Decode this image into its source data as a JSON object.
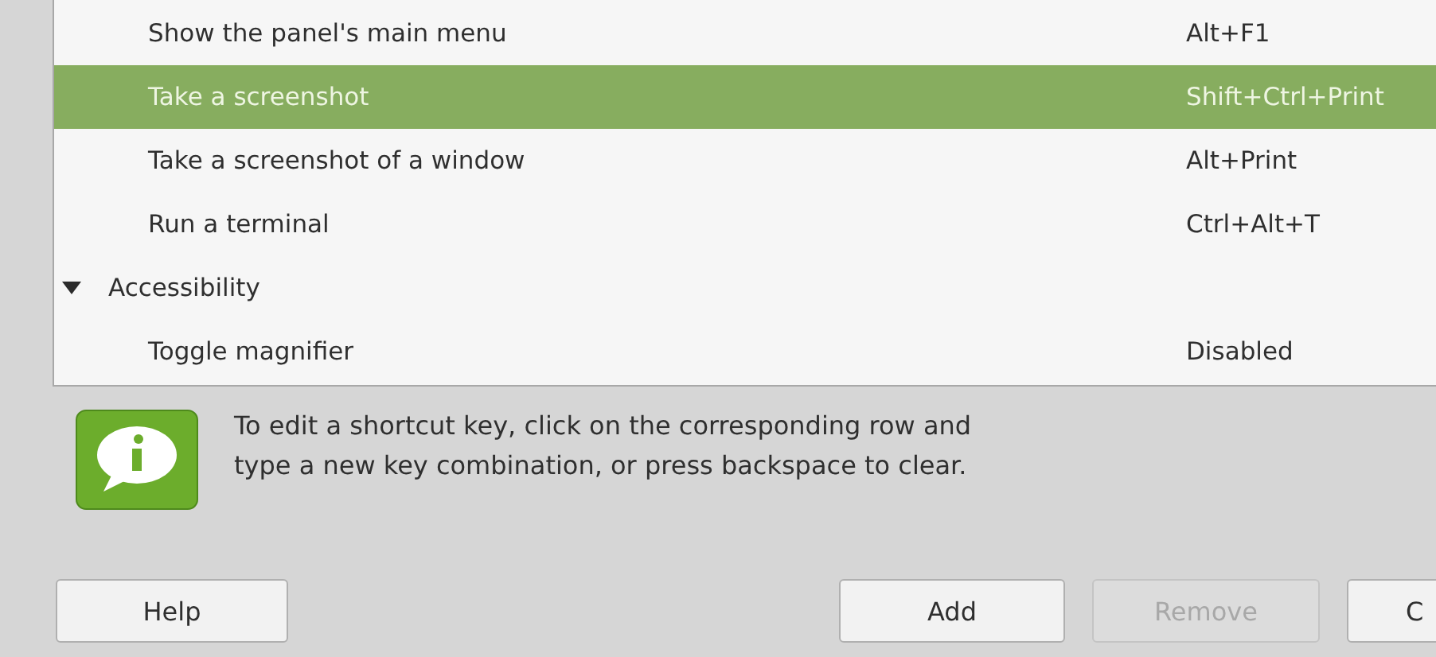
{
  "shortcuts": [
    {
      "kind": "shortcut",
      "label": "Show the panel's main menu",
      "keys": "Alt+F1",
      "selected": false
    },
    {
      "kind": "shortcut",
      "label": "Take a screenshot",
      "keys": "Shift+Ctrl+Print",
      "selected": true
    },
    {
      "kind": "shortcut",
      "label": "Take a screenshot of a window",
      "keys": "Alt+Print",
      "selected": false
    },
    {
      "kind": "shortcut",
      "label": "Run a terminal",
      "keys": "Ctrl+Alt+T",
      "selected": false
    },
    {
      "kind": "category",
      "label": "Accessibility",
      "expanded": true,
      "selected": false
    },
    {
      "kind": "shortcut",
      "label": "Toggle magnifier",
      "keys": "Disabled",
      "selected": false
    }
  ],
  "info": {
    "text": "To edit a shortcut key, click on the corresponding row and type a new key combination, or press backspace to clear."
  },
  "buttons": [
    {
      "label": "Help",
      "disabled": false
    },
    {
      "label": "Add",
      "disabled": false
    },
    {
      "label": "Remove",
      "disabled": true
    },
    {
      "label": "C",
      "disabled": false
    }
  ]
}
